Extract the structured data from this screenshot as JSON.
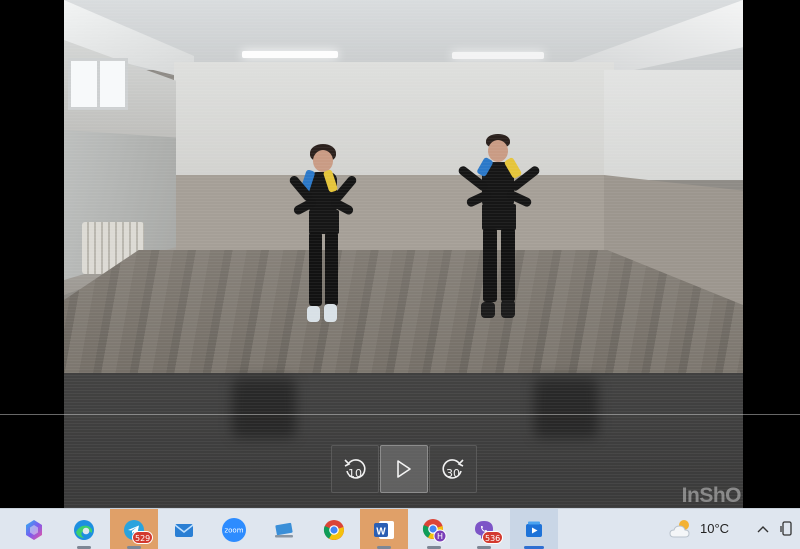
{
  "player": {
    "skip_back_value": "10",
    "skip_forward_value": "30",
    "progress_fraction": 0.0,
    "watermark": "InShO"
  },
  "taskbar": {
    "items": [
      {
        "icon": "copilot-icon",
        "badge": ""
      },
      {
        "icon": "edge-icon",
        "badge": ""
      },
      {
        "icon": "telegram-icon",
        "badge": "529"
      },
      {
        "icon": "mail-icon",
        "badge": ""
      },
      {
        "icon": "zoom-icon",
        "badge": "",
        "label": "zoom"
      },
      {
        "icon": "pc-icon",
        "badge": ""
      },
      {
        "icon": "chrome-icon",
        "badge": ""
      },
      {
        "icon": "word-icon",
        "badge": "",
        "label": "W"
      },
      {
        "icon": "chrome-profile-icon",
        "badge": "",
        "label": "H"
      },
      {
        "icon": "viber-icon",
        "badge": "536"
      },
      {
        "icon": "media-player-icon",
        "badge": ""
      }
    ]
  },
  "tray": {
    "temperature": "10°C"
  },
  "colors": {
    "taskbar_bg": "#dfe6ef",
    "accent": "#2f6fd1",
    "badge": "#d33a2f",
    "highlight": "#e0a068"
  }
}
